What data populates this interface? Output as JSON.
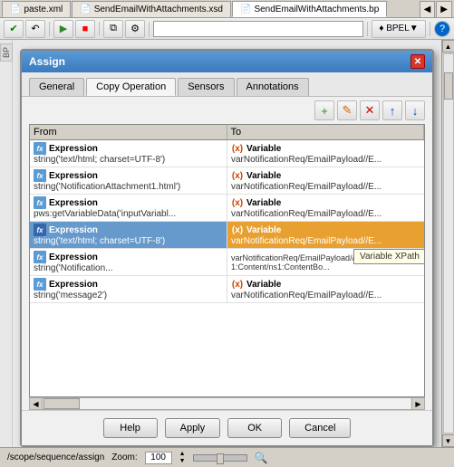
{
  "tabs": [
    {
      "label": "paste.xml",
      "icon": "📄",
      "active": false
    },
    {
      "label": "SendEmailWithAttachments.xsd",
      "icon": "📄",
      "active": false
    },
    {
      "label": "SendEmailWithAttachments.bp",
      "icon": "📄",
      "active": true
    }
  ],
  "toolbar": {
    "address_value": "",
    "bpel_label": "♦ BPEL▼",
    "help_icon": "?"
  },
  "dialog": {
    "title": "Assign",
    "close_label": "✕",
    "tabs": [
      {
        "label": "General",
        "active": false
      },
      {
        "label": "Copy Operation",
        "active": true
      },
      {
        "label": "Sensors",
        "active": false
      },
      {
        "label": "Annotations",
        "active": false
      }
    ],
    "toolbar_buttons": [
      {
        "icon": "+",
        "color": "green",
        "label": "add"
      },
      {
        "icon": "✎",
        "color": "orange",
        "label": "edit"
      },
      {
        "icon": "✕",
        "color": "red",
        "label": "delete"
      },
      {
        "icon": "↑",
        "color": "blue",
        "label": "up"
      },
      {
        "icon": "↓",
        "color": "blue",
        "label": "down"
      }
    ],
    "table": {
      "headers": [
        "From",
        "To"
      ],
      "rows": [
        {
          "from_type": "Expression",
          "from_value": "string('text/html; charset=UTF-8')",
          "to_type": "Variable",
          "to_value": "varNotificationReq/EmailPayload//E...",
          "selected": false
        },
        {
          "from_type": "Expression",
          "from_value": "string('NotificationAttachment1.html')",
          "to_type": "Variable",
          "to_value": "varNotificationReq/EmailPayload//E...",
          "selected": false
        },
        {
          "from_type": "Expression",
          "from_value": "pws:getVariableData('inputVariabl...",
          "to_type": "Variable",
          "to_value": "varNotificationReq/EmailPayload//E...",
          "selected": false
        },
        {
          "from_type": "Expression",
          "from_value": "string('text/html; charset=UTF-8')",
          "to_type": "Variable",
          "to_value": "varNotificationReq/EmailPayload//E...",
          "selected": true
        },
        {
          "from_type": "Expression",
          "from_value": "string('Notification...",
          "to_type": "Variable",
          "to_value": "varNotificationReq/EmailPayload//EmailPayload/ns1:Content/ns1:ContentBo...",
          "selected": false,
          "show_tooltip": true
        },
        {
          "from_type": "Expression",
          "from_value": "string('message2')",
          "to_type": "Variable",
          "to_value": "varNotificationReq/EmailPayload//E...",
          "selected": false
        }
      ]
    },
    "tooltip": "Variable XPath",
    "buttons": {
      "help": "Help",
      "apply": "Apply",
      "ok": "OK",
      "cancel": "Cancel"
    }
  },
  "status_bar": {
    "path": "/scope/sequence/assign",
    "zoom_label": "Zoom:",
    "zoom_value": "100",
    "zoom_unit": ""
  }
}
